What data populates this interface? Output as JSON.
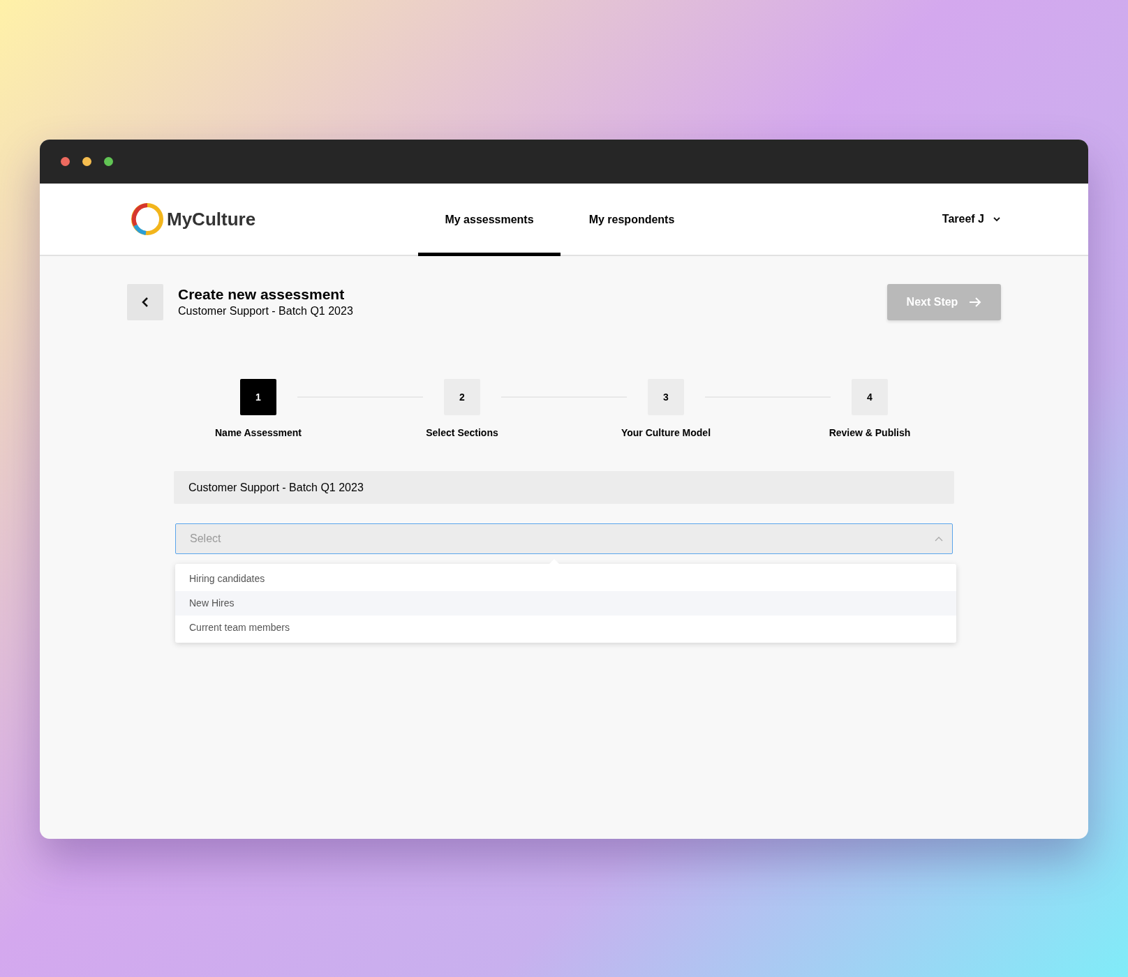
{
  "app": {
    "logo_text": "MyCulture",
    "nav_tabs": [
      {
        "label": "My assessments",
        "selected": true
      },
      {
        "label": "My respondents",
        "selected": false
      }
    ],
    "user_menu": {
      "label": "Tareef J"
    }
  },
  "page_header": {
    "title": "Create new assessment",
    "subtitle": "Customer Support - Batch Q1 2023",
    "next_button": {
      "label": "Next Step",
      "disabled": true
    }
  },
  "steps": [
    {
      "number": "1",
      "label": "Name Assessment",
      "active": true
    },
    {
      "number": "2",
      "label": "Select Sections",
      "active": false
    },
    {
      "number": "3",
      "label": "Your Culture Model",
      "active": false
    },
    {
      "number": "4",
      "label": "Review & Publish",
      "active": false
    }
  ],
  "name_field": {
    "value": "Customer Support - Batch Q1 2023"
  },
  "respondent_select": {
    "placeholder": "Select",
    "expanded": true,
    "options": [
      {
        "label": "Hiring candidates",
        "highlighted": false
      },
      {
        "label": "New Hires",
        "highlighted": true
      },
      {
        "label": "Current team members",
        "highlighted": false
      }
    ]
  }
}
